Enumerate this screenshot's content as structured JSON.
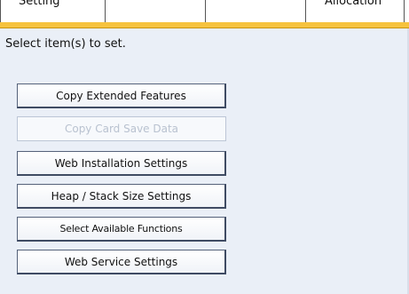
{
  "tabs": [
    {
      "label": "Setting"
    },
    {
      "label": "Allocation"
    }
  ],
  "prompt": "Select item(s) to set.",
  "buttons": [
    {
      "label": "Copy Extended Features",
      "enabled": true
    },
    {
      "label": "Copy Card Save Data",
      "enabled": false
    },
    {
      "label": "Web Installation Settings",
      "enabled": true
    },
    {
      "label": "Heap / Stack Size Settings",
      "enabled": true
    },
    {
      "label": "Select Available Functions",
      "enabled": true
    },
    {
      "label": "Web Service Settings",
      "enabled": true
    }
  ]
}
